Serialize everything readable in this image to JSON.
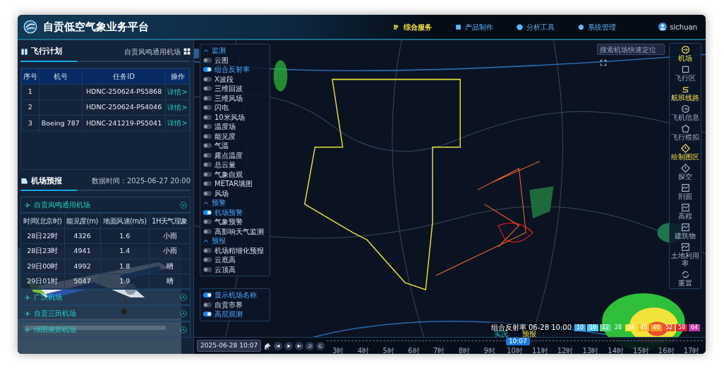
{
  "app": {
    "title": "自贡低空气象业务平台",
    "user": "sichuan"
  },
  "nav": [
    {
      "label": "综合服务",
      "selected": true
    },
    {
      "label": "产品制作",
      "selected": false
    },
    {
      "label": "分析工具",
      "selected": false
    },
    {
      "label": "系统管理",
      "selected": false
    }
  ],
  "flight_plan": {
    "title": "飞行计划",
    "airport": "自贡凤鸣通用机场",
    "columns": [
      "序号",
      "机号",
      "任务ID",
      "操作"
    ],
    "rows": [
      [
        "1",
        "",
        "HDNC-250624-PS5868",
        "详情>"
      ],
      [
        "2",
        "",
        "HDNC-250624-PS4046",
        "详情>"
      ],
      [
        "3",
        "Boeing 787",
        "HDNC-241219-PS5041",
        "详情>"
      ]
    ]
  },
  "airport_forecast": {
    "title": "机场预报",
    "data_time": "数据时间：2025-06-27 20:00",
    "airports": [
      {
        "name": "自贡凤鸣通用机场",
        "expanded": true,
        "columns": [
          "时间(北京时)",
          "能见度(m)",
          "地面风速(m/s)",
          "1H天气现象"
        ],
        "rows": [
          [
            "28日22时",
            "4326",
            "1.6",
            "小雨"
          ],
          [
            "28日23时",
            "4941",
            "1.4",
            "小雨"
          ],
          [
            "29日00时",
            "4992",
            "1.8",
            "晴"
          ],
          [
            "29日01时",
            "5047",
            "1.9",
            "晴"
          ]
        ]
      },
      {
        "name": "广汉机场",
        "expanded": false
      },
      {
        "name": "自贡三田机场",
        "expanded": false
      },
      {
        "name": "绵阳南郊机场",
        "expanded": false
      }
    ]
  },
  "layers": {
    "groups": [
      {
        "title": "监测",
        "expanded": true,
        "items": [
          {
            "label": "云图",
            "on": false
          },
          {
            "label": "组合反射率",
            "on": true
          },
          {
            "label": "X波段",
            "on": false
          },
          {
            "label": "三维回波",
            "on": false
          },
          {
            "label": "三维风场",
            "on": false
          },
          {
            "label": "闪电",
            "on": false
          },
          {
            "label": "10米风场",
            "on": false
          },
          {
            "label": "温度场",
            "on": false
          },
          {
            "label": "能见度",
            "on": false
          },
          {
            "label": "气温",
            "on": false
          },
          {
            "label": "露点温度",
            "on": false
          },
          {
            "label": "总云量",
            "on": false
          },
          {
            "label": "气象自观",
            "on": false
          },
          {
            "label": "METAR填图",
            "on": false
          },
          {
            "label": "风场",
            "on": false
          }
        ]
      },
      {
        "title": "预警",
        "expanded": true,
        "items": [
          {
            "label": "机场预警",
            "on": true
          },
          {
            "label": "气象预警",
            "on": false
          },
          {
            "label": "高影响天气监测",
            "on": false
          }
        ]
      },
      {
        "title": "预报",
        "expanded": true,
        "items": [
          {
            "label": "机场精细化预报",
            "on": false
          },
          {
            "label": "云底高",
            "on": false
          },
          {
            "label": "云顶高",
            "on": false
          }
        ]
      }
    ],
    "extras": [
      {
        "label": "显示机场名称",
        "on": true
      },
      {
        "label": "自贡市界",
        "on": false
      },
      {
        "label": "高层观测",
        "on": true
      }
    ]
  },
  "search": {
    "placeholder": "搜索机场快速定位"
  },
  "tools": [
    {
      "label": "机场",
      "active": true,
      "kind": "plane"
    },
    {
      "label": "飞行区",
      "active": false,
      "kind": "area"
    },
    {
      "label": "航班线路",
      "active": true,
      "kind": "route"
    },
    {
      "label": "飞机信息",
      "active": false,
      "kind": "plane"
    },
    {
      "label": "飞行模拟",
      "active": false,
      "kind": "sim"
    },
    {
      "label": "绘制图区",
      "active": true,
      "kind": "warn"
    },
    {
      "label": "探空",
      "active": false,
      "kind": "warn"
    },
    {
      "label": "剖面",
      "active": false,
      "kind": "chart"
    },
    {
      "label": "高程",
      "active": false,
      "kind": "chart"
    },
    {
      "label": "建筑物",
      "active": false,
      "kind": "chart"
    },
    {
      "label": "土地利用率",
      "active": false,
      "kind": "chart"
    },
    {
      "label": "重置",
      "active": false,
      "kind": "reset"
    }
  ],
  "legend": {
    "title": "组合反射率 06-28 10:00",
    "steps": [
      {
        "value": "10",
        "color": "#3fa9f5"
      },
      {
        "value": "16",
        "color": "#4fd0f0"
      },
      {
        "value": "22",
        "color": "#52d88a"
      },
      {
        "value": "28",
        "color": "#2fbf3a"
      },
      {
        "value": "34",
        "color": "#f2e33a"
      },
      {
        "value": "40",
        "color": "#f6c02b"
      },
      {
        "value": "46",
        "color": "#f39a2b"
      },
      {
        "value": "52",
        "color": "#e8502e"
      },
      {
        "value": "58",
        "color": "#d8203a"
      },
      {
        "value": "64",
        "color": "#c23aa8"
      }
    ]
  },
  "timeline": {
    "date": "2025-06-28 10:07",
    "observed": "实况",
    "forecast": "预报",
    "current": "10:07",
    "hours": [
      "3时",
      "4时",
      "5时",
      "6时",
      "7时",
      "8时",
      "9时",
      "10时",
      "11时",
      "12时",
      "13时",
      "14时",
      "15时",
      "16时",
      "17时"
    ]
  }
}
